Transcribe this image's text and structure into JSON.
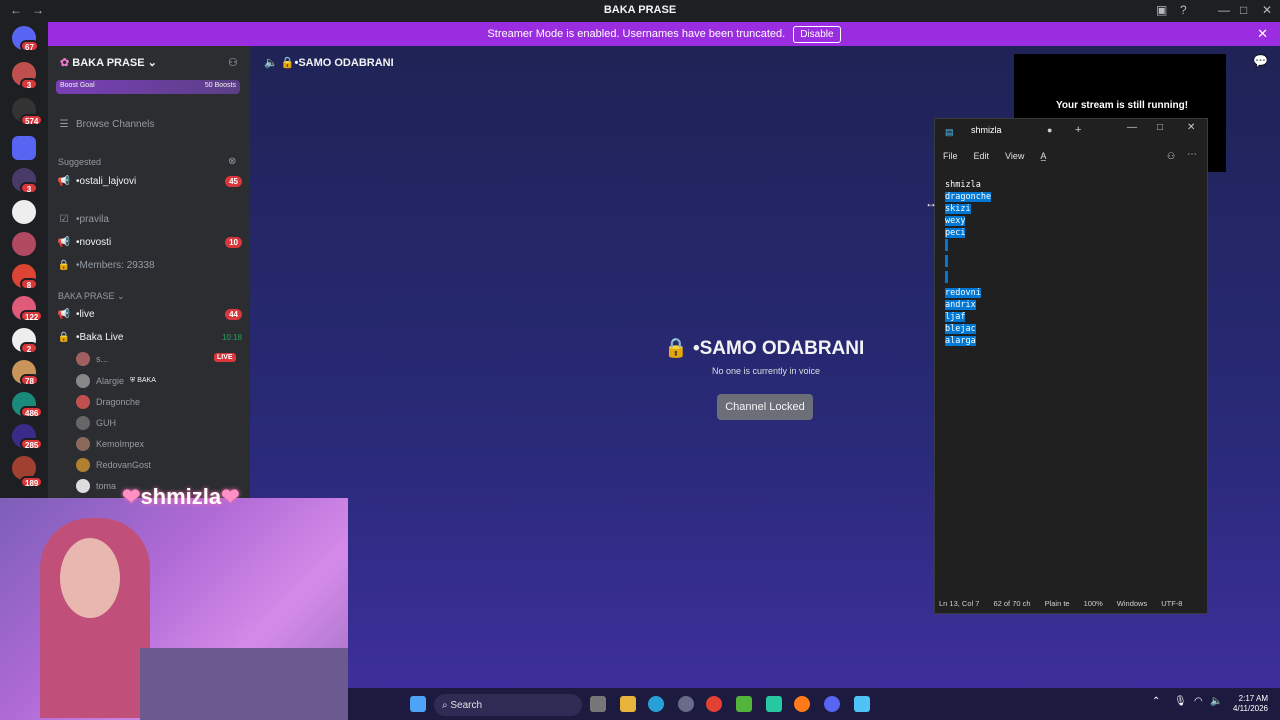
{
  "titlebar": {
    "title": "BAKA PRASE"
  },
  "banner": {
    "text": "Streamer Mode is enabled. Usernames have been truncated.",
    "button": "Disable"
  },
  "rail": {
    "badges": [
      "67",
      "3",
      "574",
      "3",
      "8",
      "122",
      "2",
      "78",
      "486",
      "285",
      "189"
    ]
  },
  "sidebar": {
    "server_name": "BAKA PRASE",
    "boost_goal": "Boost Goal",
    "boost_count": "50 Boosts",
    "browse": "Browse Channels",
    "suggested_label": "Suggested",
    "channels": [
      {
        "name": "•ostali_lajvovi",
        "count": "45"
      },
      {
        "name": "•pravila",
        "count": ""
      },
      {
        "name": "•novosti",
        "count": "10"
      },
      {
        "name": "•Members: 29338",
        "count": ""
      }
    ],
    "category": "BAKA PRASE",
    "live_channel": {
      "name": "•live",
      "count": "44"
    },
    "voice_channel": {
      "name": "•Baka Live",
      "time": "10:18"
    },
    "voice_users": [
      "s...",
      "Alargie",
      "Dragonche",
      "GUH",
      "KemoImpex",
      "RedovanGost",
      "toma"
    ],
    "live_badge": "LIVE",
    "baka_tag": "BAKA"
  },
  "main": {
    "header": "•SAMO ODABRANI",
    "voice_title": "•SAMO ODABRANI",
    "voice_sub": "No one is currently in voice",
    "locked_button": "Channel Locked"
  },
  "stream_popup": {
    "text": "Your stream is still running!"
  },
  "notepad": {
    "tab": "shmizla",
    "menu": [
      "File",
      "Edit",
      "View"
    ],
    "lines": [
      "shmizla",
      "dragonche",
      "skizi",
      "wexy",
      "peci",
      "",
      "",
      "",
      "redovni",
      "andrix",
      "ljaf",
      "blejac",
      "alarga"
    ],
    "status": [
      "Ln 13, Col 7",
      "62 of 70 ch",
      "Plain te",
      "100%",
      "Windows",
      "UTF-8"
    ]
  },
  "cam": {
    "label": "shmizla"
  },
  "taskbar": {
    "search": "Search",
    "time": "2:17 AM",
    "date": "4/11/2026"
  }
}
